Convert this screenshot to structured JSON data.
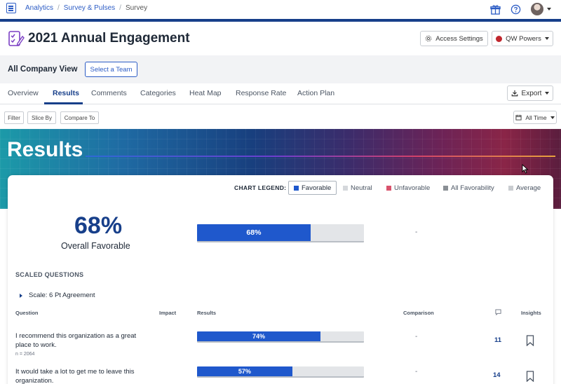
{
  "breadcrumb": {
    "items": [
      "Analytics",
      "Survey & Pulses",
      "Survey"
    ]
  },
  "header": {
    "title": "2021 Annual Engagement",
    "access_settings": "Access Settings",
    "qw_powers": "QW Powers"
  },
  "view": {
    "label": "All Company View",
    "select_team": "Select a Team"
  },
  "tabs": [
    "Overview",
    "Results",
    "Comments",
    "Categories",
    "Heat Map",
    "Response Rate",
    "Action Plan"
  ],
  "active_tab": "Results",
  "export_label": "Export",
  "filters": {
    "filter": "Filter",
    "slice_by": "Slice By",
    "compare_to": "Compare To",
    "time": "All Time"
  },
  "banner": {
    "title": "Results"
  },
  "legend": {
    "label": "CHART LEGEND:",
    "items": [
      {
        "label": "Favorable",
        "color": "#1f58cc"
      },
      {
        "label": "Neutral",
        "color": "#d5d8dc"
      },
      {
        "label": "Unfavorable",
        "color": "#d9536d"
      },
      {
        "label": "All Favorability",
        "color": "#8a8f95"
      },
      {
        "label": "Average",
        "color": "#c9ccd0"
      }
    ]
  },
  "overall": {
    "percent_label": "68%",
    "percent": 68,
    "label": "Overall Favorable",
    "comparison": "-"
  },
  "scaled": {
    "title": "SCALED QUESTIONS",
    "scale_name": "Scale: 6 Pt Agreement",
    "columns": {
      "question": "Question",
      "impact": "Impact",
      "results": "Results",
      "comparison": "Comparison",
      "insights": "Insights"
    },
    "questions": [
      {
        "text": "I recommend this organization as a great place to work.",
        "n": "n = 2064",
        "percent_label": "74%",
        "percent": 74,
        "comparison": "-",
        "comments": "11"
      },
      {
        "text": "It would take a lot to get me to leave this organization.",
        "n": "",
        "percent_label": "57%",
        "percent": 57,
        "comparison": "-",
        "comments": "14"
      }
    ]
  },
  "colors": {
    "brand": "#173f8a",
    "accent": "#2c5cc5",
    "favorable": "#1f58cc"
  }
}
